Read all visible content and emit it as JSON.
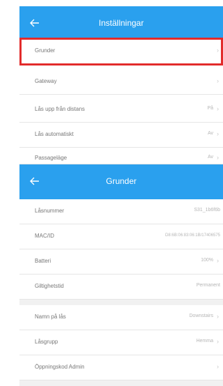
{
  "screen1": {
    "title": "Inställningar",
    "items": [
      {
        "label": "Grunder",
        "value": "",
        "chevron": "›"
      },
      {
        "label": "Gateway",
        "value": "",
        "chevron": "›"
      },
      {
        "label": "Lås upp från distans",
        "value": "På",
        "chevron": "›"
      },
      {
        "label": "Lås automatiskt",
        "value": "Av",
        "chevron": "›"
      },
      {
        "label": "Passageläge",
        "value": "Av",
        "chevron": "›"
      }
    ]
  },
  "screen2": {
    "title": "Grunder",
    "items": [
      {
        "label": "Låsnummer",
        "value": "S31_1b6f6b",
        "chevron": ""
      },
      {
        "label": "MAC/ID",
        "value": "D8:6B:06:83:06:1B/17406575",
        "chevron": ""
      },
      {
        "label": "Batteri",
        "value": "100%",
        "chevron": "›"
      },
      {
        "label": "Giltighetstid",
        "value": "Permanent",
        "chevron": ""
      },
      {
        "label": "Namn på lås",
        "value": "Downstairs",
        "chevron": "›"
      },
      {
        "label": "Låsgrupp",
        "value": "Hemma",
        "chevron": "›"
      },
      {
        "label": "Öppningskod Admin",
        "value": "",
        "chevron": "›"
      }
    ]
  },
  "colors": {
    "header": "#2aa0ee",
    "highlight": "#e22b2b"
  }
}
